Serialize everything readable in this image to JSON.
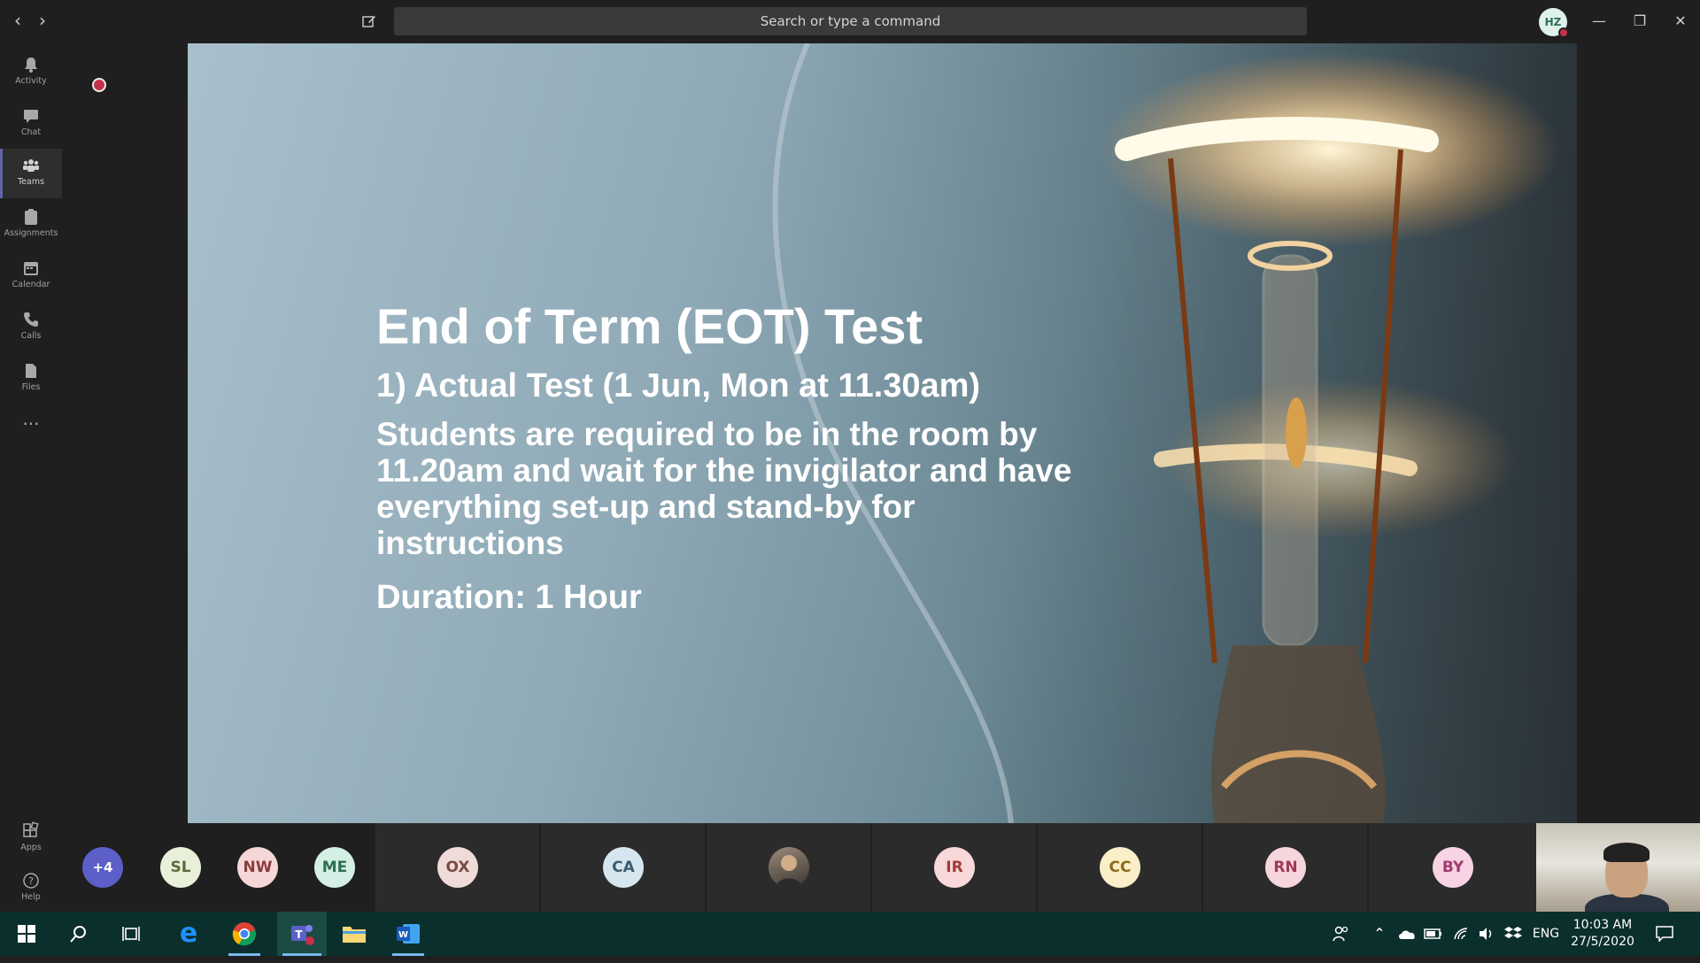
{
  "titlebar": {
    "search_placeholder": "Search or type a command",
    "user_initials": "HZ"
  },
  "rail": {
    "items": [
      {
        "label": "Activity",
        "icon": "bell-icon"
      },
      {
        "label": "Chat",
        "icon": "chat-icon"
      },
      {
        "label": "Teams",
        "icon": "teams-icon",
        "active": true
      },
      {
        "label": "Assignments",
        "icon": "assignments-icon"
      },
      {
        "label": "Calendar",
        "icon": "calendar-icon"
      },
      {
        "label": "Calls",
        "icon": "phone-icon"
      },
      {
        "label": "Files",
        "icon": "files-icon"
      },
      {
        "label": "...",
        "icon": "more-icon"
      }
    ],
    "bottom": [
      {
        "label": "Apps",
        "icon": "apps-icon"
      },
      {
        "label": "Help",
        "icon": "help-icon"
      }
    ]
  },
  "slide": {
    "title": "End of Term (EOT) Test",
    "subtitle": "1) Actual Test (1 Jun, Mon at 11.30am)",
    "body": "Students are required to be in the room by 11.20am and wait for the invigilator and have everything set-up and stand-by for instructions",
    "duration": "Duration: 1 Hour"
  },
  "participants": {
    "overflow": "+4",
    "list": [
      {
        "initials": "SL",
        "bg": "#e8f0da",
        "fg": "#5b6b3a"
      },
      {
        "initials": "NW",
        "bg": "#f6d7d7",
        "fg": "#8a3b3b"
      },
      {
        "initials": "ME",
        "bg": "#d4efe3",
        "fg": "#2d6e55"
      },
      {
        "initials": "OX",
        "bg": "#efdcd9",
        "fg": "#7b4a43"
      },
      {
        "initials": "CA",
        "bg": "#d6e6ef",
        "fg": "#3a5c71"
      },
      {
        "initials": "",
        "bg": "#6b6b6b",
        "fg": "#ffffff"
      },
      {
        "initials": "IR",
        "bg": "#f8d8d8",
        "fg": "#a33b3b"
      },
      {
        "initials": "CC",
        "bg": "#fbefc9",
        "fg": "#8a6a1c"
      },
      {
        "initials": "RN",
        "bg": "#f6d5dd",
        "fg": "#a03a55"
      },
      {
        "initials": "BY",
        "bg": "#f7d3e4",
        "fg": "#a03a6e"
      }
    ]
  },
  "taskbar": {
    "language": "ENG",
    "time": "10:03 AM",
    "date": "27/5/2020"
  },
  "colors": {
    "accent": "#6264a7",
    "record": "#c4314b",
    "taskbar": "#0b2f2c"
  }
}
